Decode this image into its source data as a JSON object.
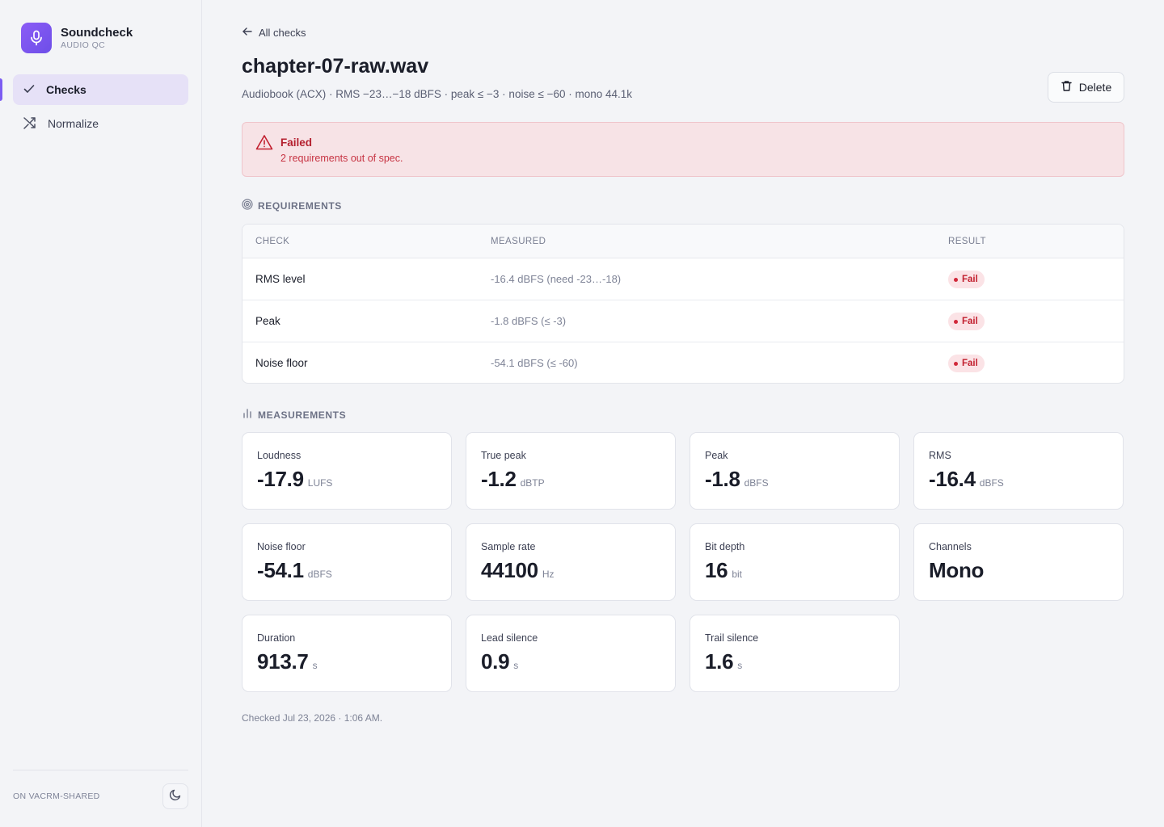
{
  "app": {
    "name": "Soundcheck",
    "subtitle": "AUDIO QC"
  },
  "sidebar": {
    "items": [
      {
        "label": "Checks",
        "icon": "check-icon",
        "active": true
      },
      {
        "label": "Normalize",
        "icon": "shuffle-icon",
        "active": false
      }
    ],
    "workspace": "ON VACRM-SHARED"
  },
  "header": {
    "back_label": "All checks",
    "title": "chapter-07-raw.wav",
    "subtitle": "Audiobook (ACX) · RMS −23…−18 dBFS · peak ≤ −3 · noise ≤ −60 · mono 44.1k",
    "delete_label": "Delete"
  },
  "alert": {
    "title": "Failed",
    "message": "2 requirements out of spec.",
    "colors": {
      "background": "#f7e3e6",
      "text": "#b4202f"
    }
  },
  "requirements": {
    "label": "REQUIREMENTS",
    "columns": [
      "CHECK",
      "MEASURED",
      "RESULT"
    ],
    "rows": [
      {
        "check": "RMS level",
        "measured": "-16.4 dBFS (need -23…-18)",
        "result": "Fail"
      },
      {
        "check": "Peak",
        "measured": "-1.8 dBFS (≤ -3)",
        "result": "Fail"
      },
      {
        "check": "Noise floor",
        "measured": "-54.1 dBFS (≤ -60)",
        "result": "Fail"
      }
    ]
  },
  "measurements": {
    "label": "MEASUREMENTS",
    "cards": [
      {
        "label": "Loudness",
        "value": "-17.9",
        "unit": "LUFS"
      },
      {
        "label": "True peak",
        "value": "-1.2",
        "unit": "dBTP"
      },
      {
        "label": "Peak",
        "value": "-1.8",
        "unit": "dBFS"
      },
      {
        "label": "RMS",
        "value": "-16.4",
        "unit": "dBFS"
      },
      {
        "label": "Noise floor",
        "value": "-54.1",
        "unit": "dBFS"
      },
      {
        "label": "Sample rate",
        "value": "44100",
        "unit": "Hz"
      },
      {
        "label": "Bit depth",
        "value": "16",
        "unit": "bit"
      },
      {
        "label": "Channels",
        "value": "Mono",
        "unit": ""
      },
      {
        "label": "Duration",
        "value": "913.7",
        "unit": "s"
      },
      {
        "label": "Lead silence",
        "value": "0.9",
        "unit": "s"
      },
      {
        "label": "Trail silence",
        "value": "1.6",
        "unit": "s"
      }
    ]
  },
  "footer": {
    "checked": "Checked Jul 23, 2026 · 1:06 AM."
  },
  "colors": {
    "accent": "#7c5cf2",
    "fail": "#c2202f"
  }
}
